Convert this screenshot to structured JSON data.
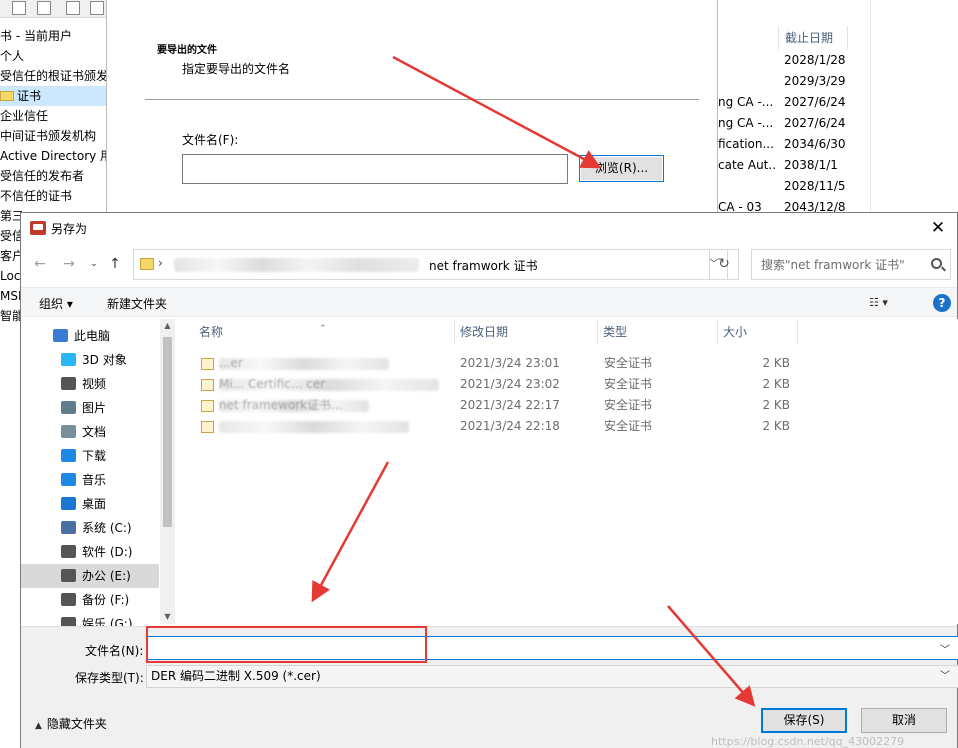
{
  "background_window": {
    "tree_items": [
      "书 - 当前用户",
      "个人",
      "受信任的根证书颁发",
      "证书",
      "企业信任",
      "中间证书颁发机构",
      "Active Directory 用",
      "受信任的发布者",
      "不信任的证书",
      "第三",
      "受信",
      "客户",
      "Loca",
      "MSI",
      "智能"
    ],
    "column_header": "截止日期",
    "rows": [
      {
        "issuer": "",
        "expiry": "2028/1/28"
      },
      {
        "issuer": "",
        "expiry": "2029/3/29"
      },
      {
        "issuer": "ng CA -...",
        "expiry": "2027/6/24"
      },
      {
        "issuer": "ng CA -...",
        "expiry": "2027/6/24"
      },
      {
        "issuer": "fication...",
        "expiry": "2034/6/30"
      },
      {
        "issuer": "cate Aut...",
        "expiry": "2038/1/1"
      },
      {
        "issuer": "",
        "expiry": "2028/11/5"
      },
      {
        "issuer": "CA - 03",
        "expiry": "2043/12/8"
      }
    ]
  },
  "wizard": {
    "heading": "要导出的文件",
    "subheading": "指定要导出的文件名",
    "filename_label": "文件名(F):",
    "filename_value": "",
    "browse_label": "浏览(R)..."
  },
  "dialog": {
    "title": "另存为",
    "address_tail": "net framwork 证书",
    "search_placeholder": "搜索\"net framwork 证书\"",
    "toolbar": {
      "organize": "组织 ▾",
      "new_folder": "新建文件夹"
    },
    "nav_items": [
      {
        "label": "此电脑",
        "icon": "computer-icon",
        "color": "#3a7bd5",
        "indent": 0
      },
      {
        "label": "3D 对象",
        "icon": "3d-objects-icon",
        "color": "#29b6f6",
        "indent": 1
      },
      {
        "label": "视频",
        "icon": "video-icon",
        "color": "#555555",
        "indent": 1
      },
      {
        "label": "图片",
        "icon": "pictures-icon",
        "color": "#607d8b",
        "indent": 1
      },
      {
        "label": "文档",
        "icon": "documents-icon",
        "color": "#78909c",
        "indent": 1
      },
      {
        "label": "下载",
        "icon": "download-icon",
        "color": "#1e88e5",
        "indent": 1
      },
      {
        "label": "音乐",
        "icon": "music-icon",
        "color": "#1e88e5",
        "indent": 1
      },
      {
        "label": "桌面",
        "icon": "desktop-icon",
        "color": "#1976d2",
        "indent": 1
      },
      {
        "label": "系统 (C:)",
        "icon": "system-drive-icon",
        "color": "#4a6fa5",
        "indent": 1
      },
      {
        "label": "软件 (D:)",
        "icon": "drive-icon",
        "color": "#555555",
        "indent": 1
      },
      {
        "label": "办公 (E:)",
        "icon": "drive-icon",
        "color": "#555555",
        "indent": 1,
        "selected": true
      },
      {
        "label": "备份 (F:)",
        "icon": "drive-icon",
        "color": "#555555",
        "indent": 1
      },
      {
        "label": "娱乐 (G:)",
        "icon": "drive-icon",
        "color": "#555555",
        "indent": 1
      }
    ],
    "columns": {
      "name": "名称",
      "modified": "修改日期",
      "type": "类型",
      "size": "大小"
    },
    "files": [
      {
        "name": "...er",
        "modified": "2021/3/24 23:01",
        "type": "安全证书",
        "size": "2 KB",
        "blur_width": 170
      },
      {
        "name": "Mi... Certific... cer",
        "modified": "2021/3/24 23:02",
        "type": "安全证书",
        "size": "2 KB",
        "blur_width": 220
      },
      {
        "name": "net framework证书...",
        "modified": "2021/3/24 22:17",
        "type": "安全证书",
        "size": "2 KB",
        "blur_width": 150
      },
      {
        "name": "",
        "modified": "2021/3/24 22:18",
        "type": "安全证书",
        "size": "2 KB",
        "blur_width": 190
      }
    ],
    "filename_label": "文件名(N):",
    "filename_value": "",
    "type_label": "保存类型(T):",
    "type_value": "DER 编码二进制 X.509 (*.cer)",
    "hide_folders": "隐藏文件夹",
    "save_label": "保存(S)",
    "cancel_label": "取消",
    "watermark": "https://blog.csdn.net/qq_43002279"
  }
}
